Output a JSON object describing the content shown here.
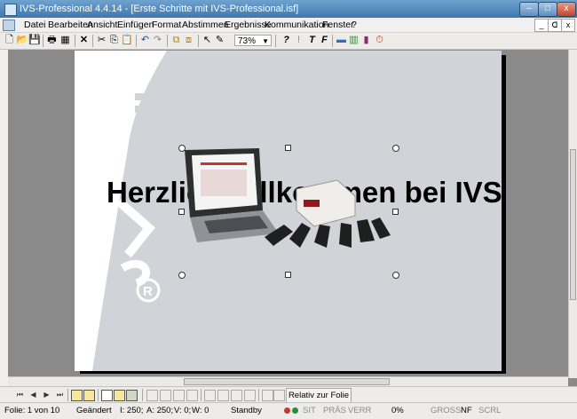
{
  "window": {
    "title": "IVS-Professional 4.4.14 - [Erste Schritte mit IVS-Professional.isf]",
    "min_glyph": "–",
    "max_glyph": "□",
    "close_glyph": "x"
  },
  "menu": {
    "items": [
      "Datei",
      "Bearbeiten",
      "Ansicht",
      "Einfügen",
      "Format",
      "Abstimmen",
      "Ergebnisse",
      "Kommunikation",
      "Fenster",
      "?"
    ],
    "mdi_min": "_",
    "mdi_max": "ᗡ",
    "mdi_close": "x"
  },
  "toolbar": {
    "zoom_value": "73%",
    "zoom_arrow": "▼",
    "icons": {
      "new": "🗋",
      "open": "📂",
      "save": "💾",
      "print": "🖶",
      "props": "▦",
      "delete": "✕",
      "cut": "✂",
      "copy": "⎘",
      "paste": "📋",
      "undo": "↶",
      "redo": "↷",
      "group": "⧉",
      "ungroup": "⧈",
      "select": "↖",
      "pen": "✎",
      "q1": "?",
      "q2": "!",
      "t1": "T",
      "f": "F",
      "img": "▬",
      "chart": "▥",
      "bars": "▮",
      "timer": "⏱"
    }
  },
  "slide": {
    "headline": "Herzlich willkommen bei IVS®"
  },
  "navigation": {
    "first": "⏮",
    "prev": "◀",
    "next": "▶",
    "last": "⏭",
    "relative_button": "Relativ zur Folie"
  },
  "statusbar": {
    "folie": "Folie: 1 von 10",
    "changed": "Geändert",
    "i_value": "I: 250;",
    "a_value": "A: 250;",
    "v_value": "V: 0;",
    "w_value": "W: 0",
    "mode": "Standby",
    "sit": "SIT",
    "praes": "PRÄS",
    "verr": "VERR",
    "percent": "0%",
    "gross": "GROSS",
    "nf": "NF",
    "scrl": "SCRL",
    "led_colors": [
      "#c0392b",
      "#2e8b3a"
    ]
  }
}
